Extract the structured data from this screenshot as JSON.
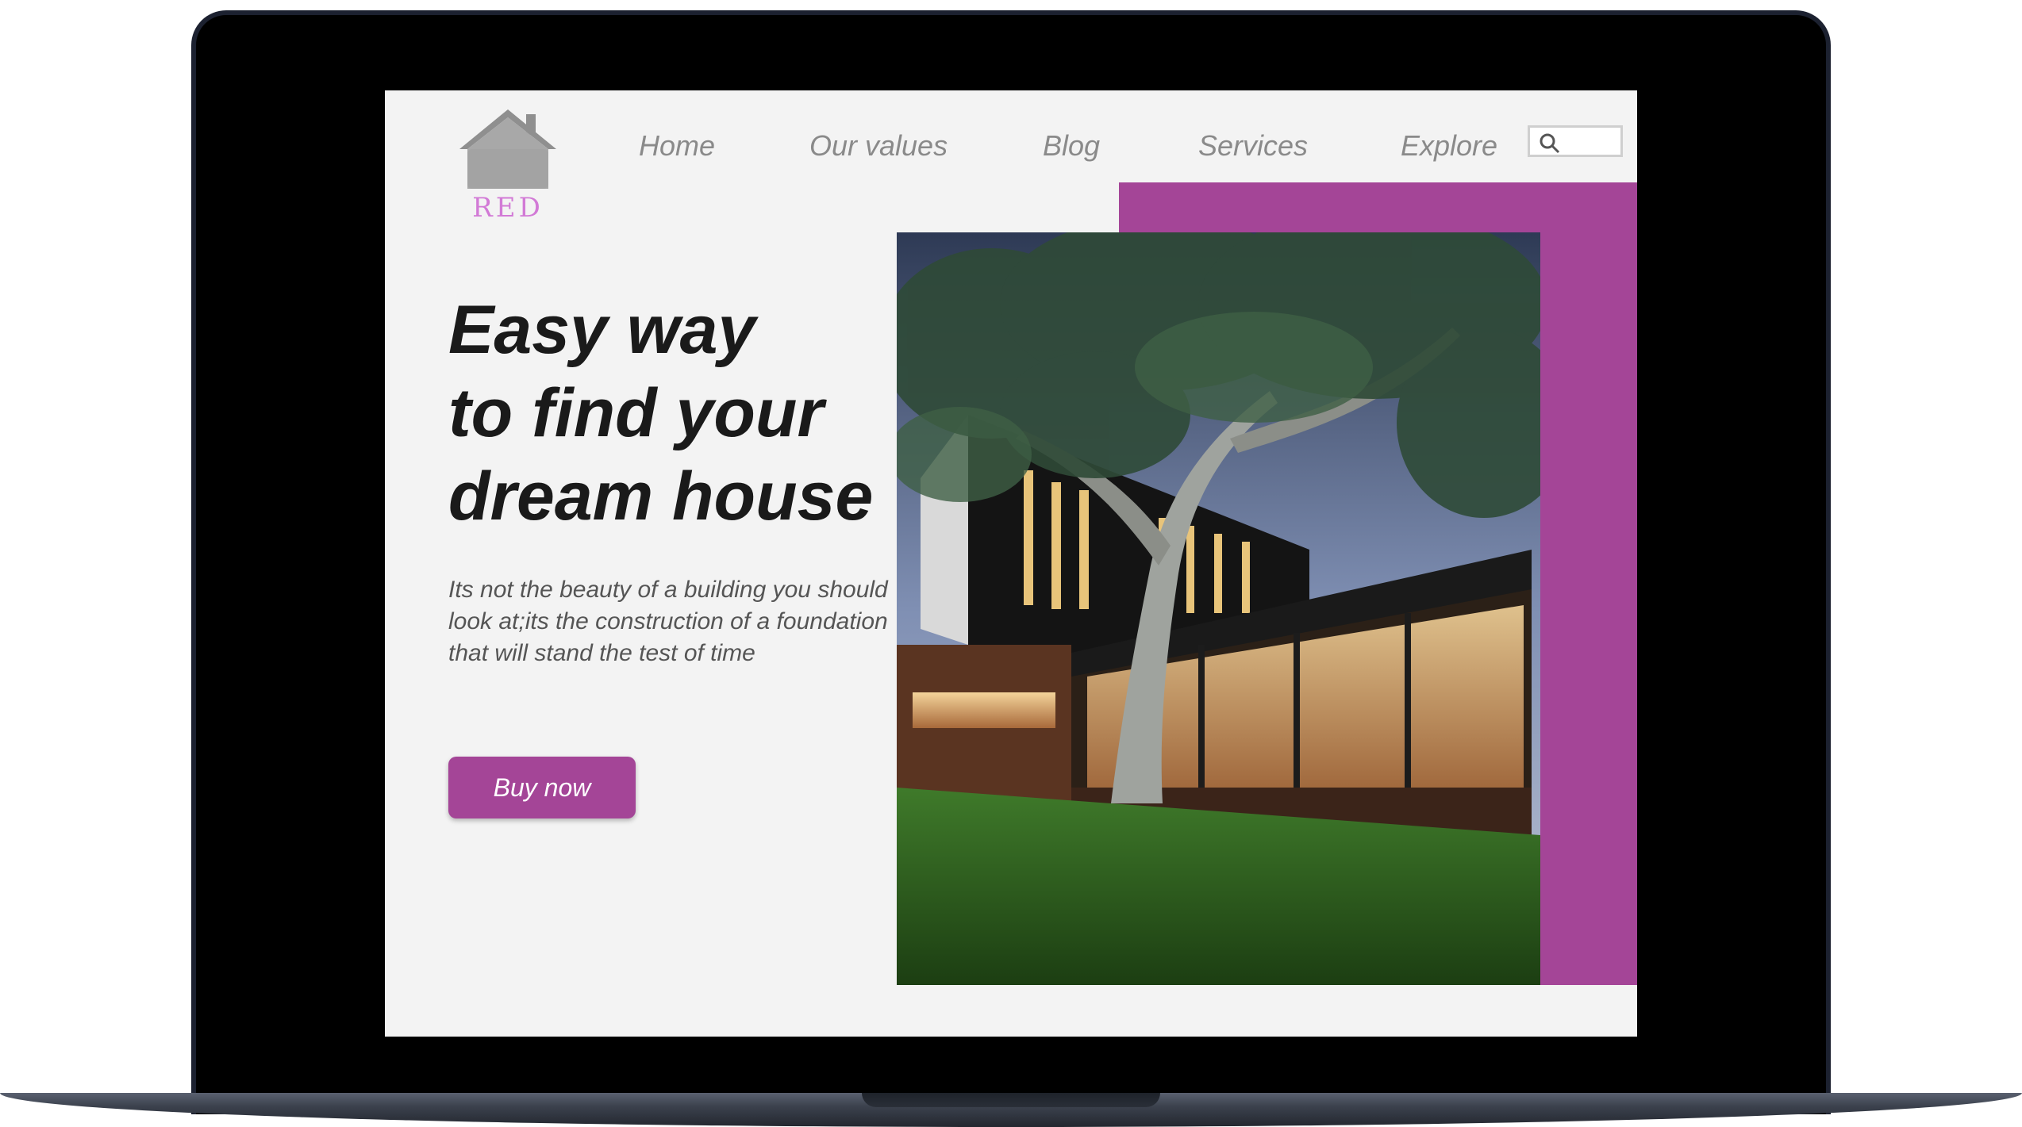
{
  "brand": {
    "logo_text": "RED",
    "logo_icon": "house-icon",
    "accent_color": "#a44597"
  },
  "nav": {
    "items": [
      {
        "label": "Home"
      },
      {
        "label": "Our values"
      },
      {
        "label": "Blog"
      },
      {
        "label": "Services"
      },
      {
        "label": "Explore"
      }
    ],
    "search_icon": "search-icon"
  },
  "hero": {
    "headline": [
      "Easy way",
      "to find your",
      "dream house"
    ],
    "tagline": "Its not the beauty of a building you should look at;its the construction of a foundation that will stand the test of time",
    "cta_label": "Buy now",
    "image": "modern-house-photo"
  }
}
